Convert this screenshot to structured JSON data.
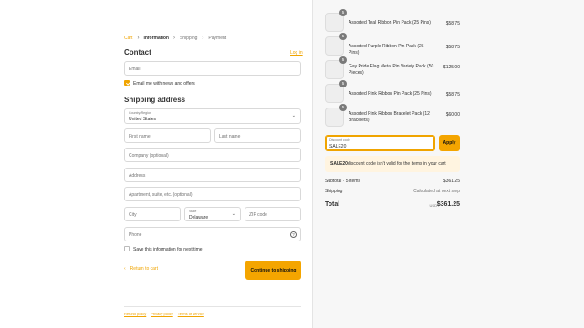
{
  "breadcrumb": [
    "Cart",
    "Information",
    "Shipping",
    "Payment"
  ],
  "contact": {
    "title": "Contact",
    "login_link": "Log in",
    "email_placeholder": "Email",
    "newsletter_label": "Email me with news and offers",
    "newsletter_checked": true
  },
  "shipping": {
    "title": "Shipping address",
    "country_label": "Country/Region",
    "country_value": "United States",
    "first_name": "First name",
    "last_name": "Last name",
    "company": "Company (optional)",
    "address": "Address",
    "apartment": "Apartment, suite, etc. (optional)",
    "city": "City",
    "state_label": "State",
    "state_value": "Delaware",
    "zip": "ZIP code",
    "phone": "Phone",
    "save_label": "Save this information for next time"
  },
  "actions": {
    "return_label": "Return to cart",
    "continue_label": "Continue to shipping"
  },
  "footer": [
    "Refund policy",
    "Privacy policy",
    "Terms of service"
  ],
  "order": {
    "items": [
      {
        "qty": "5",
        "name": "Assorted Teal Ribbon Pin Pack (25 Pins)",
        "price": "$58.75"
      },
      {
        "qty": "5",
        "name": "Assorted Purple Ribbon Pin Pack (25 Pins)",
        "price": "$58.75"
      },
      {
        "qty": "5",
        "name": "Gay Pride Flag Metal Pin Variety Pack (50 Pieces)",
        "price": "$125.00"
      },
      {
        "qty": "5",
        "name": "Assorted Pink Ribbon Pin Pack (25 Pins)",
        "price": "$58.75"
      },
      {
        "qty": "5",
        "name": "Assorted Pink Ribbon Bracelet Pack (12 Bracelets)",
        "price": "$60.00"
      }
    ],
    "discount_label": "Discount code",
    "discount_value": "SALE20",
    "apply_label": "Apply",
    "warning_code": "SALE20",
    "warning_text": "discount code isn't valid for the items in your cart",
    "subtotal_label": "Subtotal · 5 items",
    "subtotal_value": "$361.25",
    "shipping_label": "Shipping",
    "shipping_value": "Calculated at next step",
    "total_label": "Total",
    "total_currency": "USD",
    "total_value": "$361.25"
  },
  "colors": {
    "accent": "#f4a500",
    "panel": "#f7f7f7"
  }
}
